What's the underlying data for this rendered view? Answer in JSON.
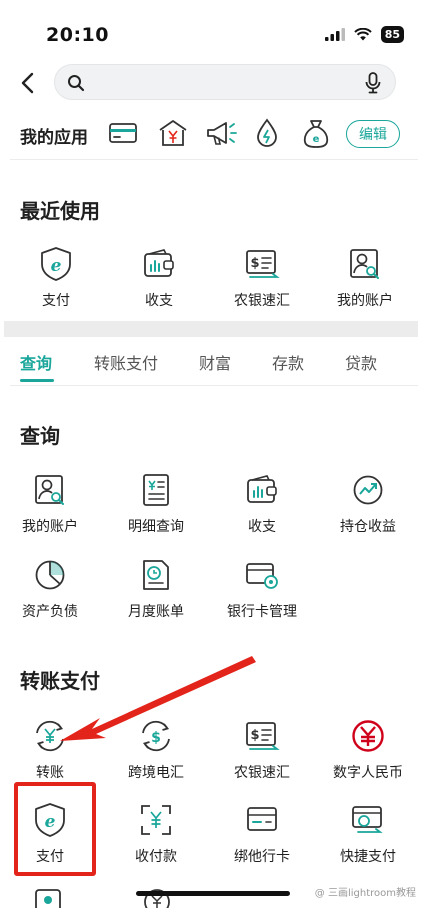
{
  "status": {
    "time": "20:10",
    "battery": "85"
  },
  "search": {
    "placeholder": "",
    "icons": [
      "search-icon",
      "microphone-icon"
    ]
  },
  "my_apps": {
    "label": "我的应用",
    "icons": [
      "card-icon",
      "bank-icon",
      "megaphone-icon",
      "drop-icon",
      "money-bag-icon"
    ],
    "edit_label": "编辑"
  },
  "recent": {
    "title": "最近使用",
    "items": [
      {
        "label": "支付",
        "icon": "e-payment-icon"
      },
      {
        "label": "收支",
        "icon": "wallet-chart-icon"
      },
      {
        "label": "农银速汇",
        "icon": "bill-transfer-icon"
      },
      {
        "label": "我的账户",
        "icon": "account-search-icon"
      }
    ]
  },
  "tabs": [
    "查询",
    "转账支付",
    "财富",
    "存款",
    "贷款"
  ],
  "query": {
    "title": "查询",
    "items": [
      {
        "label": "我的账户",
        "icon": "account-search-icon"
      },
      {
        "label": "明细查询",
        "icon": "statement-icon"
      },
      {
        "label": "收支",
        "icon": "wallet-chart-icon"
      },
      {
        "label": "持仓收益",
        "icon": "trend-icon"
      },
      {
        "label": "资产负债",
        "icon": "pie-chart-icon"
      },
      {
        "label": "月度账单",
        "icon": "monthly-bill-icon"
      },
      {
        "label": "银行卡管理",
        "icon": "bank-card-icon"
      }
    ]
  },
  "transfer": {
    "title": "转账支付",
    "items": [
      {
        "label": "转账",
        "icon": "yuan-exchange-icon"
      },
      {
        "label": "跨境电汇",
        "icon": "dollar-exchange-icon"
      },
      {
        "label": "农银速汇",
        "icon": "bill-transfer-icon"
      },
      {
        "label": "数字人民币",
        "icon": "digital-rmb-icon"
      },
      {
        "label": "支付",
        "icon": "e-payment-icon"
      },
      {
        "label": "收付款",
        "icon": "scan-yuan-icon"
      },
      {
        "label": "绑他行卡",
        "icon": "bind-card-icon"
      },
      {
        "label": "快捷支付",
        "icon": "quick-pay-icon"
      }
    ]
  },
  "colors": {
    "accent": "#1aa69a",
    "annotation": "#e3241b",
    "digital_rmb": "#d0021b"
  },
  "watermark": "@ 三画lightroom教程"
}
